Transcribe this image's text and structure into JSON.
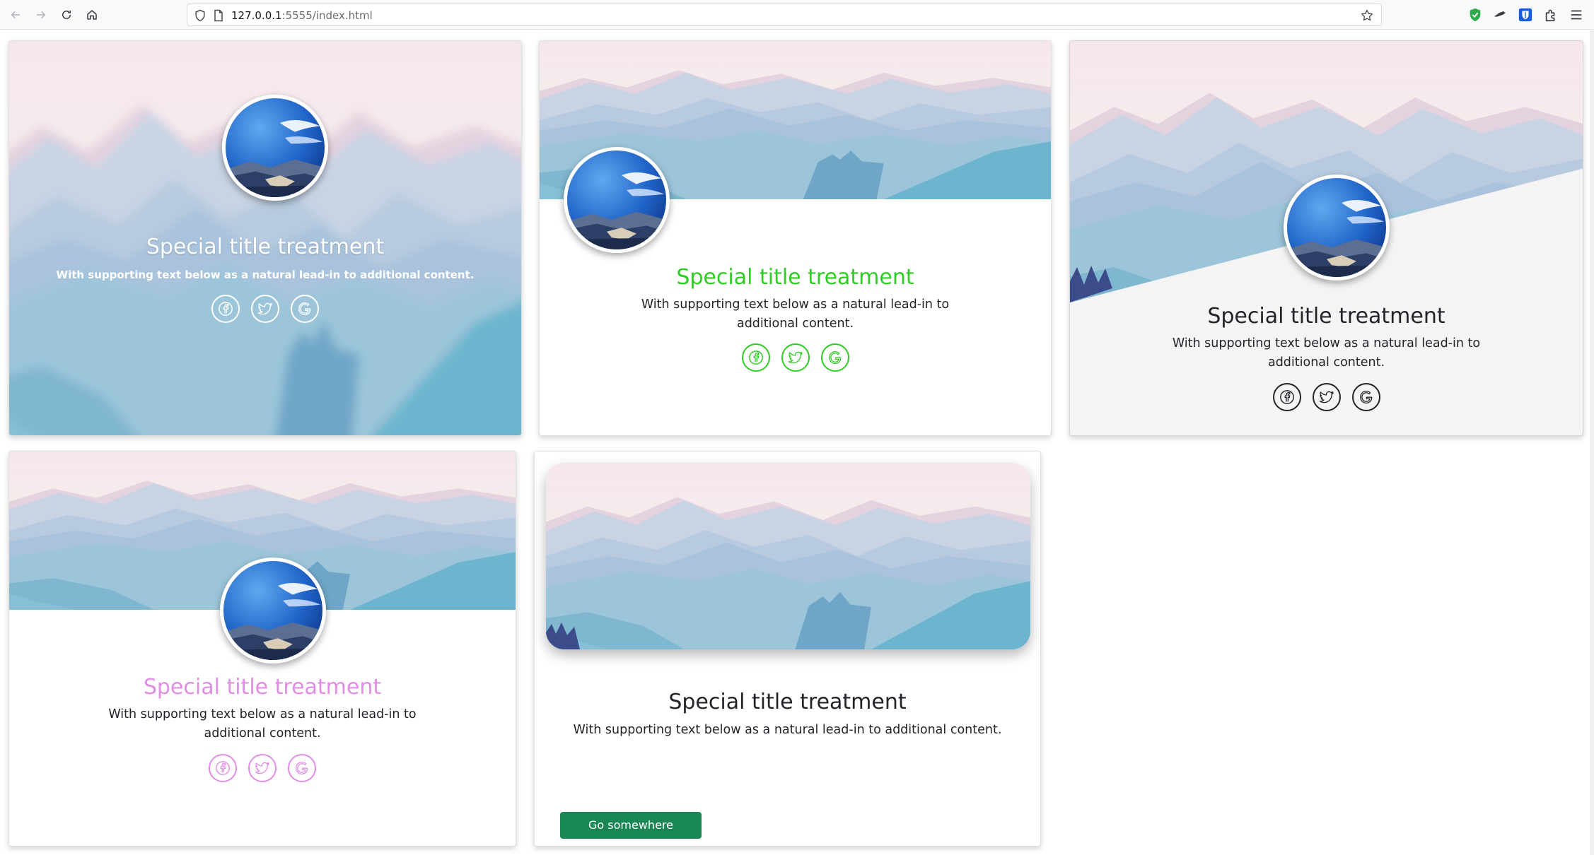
{
  "browser": {
    "url_host": "127.0.0.1",
    "url_path": ":5555/index.html",
    "icons": [
      "back-icon",
      "forward-icon",
      "reload-icon",
      "home-icon",
      "shield-icon",
      "page-icon",
      "bookmark-star-icon",
      "extension-shield-icon",
      "extension-icon",
      "extension-bitwarden-icon",
      "extensions-puzzle-icon",
      "menu-icon"
    ]
  },
  "colors": {
    "green": "#2ecc24",
    "pink": "#e08ee4",
    "dark": "#212529",
    "button_green": "#198754"
  },
  "cards": [
    {
      "title": "Special title treatment",
      "text": "With supporting text below as a natural lead-in to additional content.",
      "socials": [
        "facebook-icon",
        "twitter-icon",
        "google-icon"
      ]
    },
    {
      "title": "Special title treatment",
      "text": "With supporting text below as a natural lead-in to additional content.",
      "socials": [
        "facebook-icon",
        "twitter-icon",
        "google-icon"
      ]
    },
    {
      "title": "Special title treatment",
      "text": "With supporting text below as a natural lead-in to additional content.",
      "socials": [
        "facebook-icon",
        "twitter-icon",
        "google-icon"
      ]
    },
    {
      "title": "Special title treatment",
      "text": "With supporting text below as a natural lead-in to additional content.",
      "socials": [
        "facebook-icon",
        "twitter-icon",
        "google-icon"
      ]
    },
    {
      "title": "Special title treatment",
      "text": "With supporting text below as a natural lead-in to additional content.",
      "button_label": "Go somewhere"
    }
  ]
}
